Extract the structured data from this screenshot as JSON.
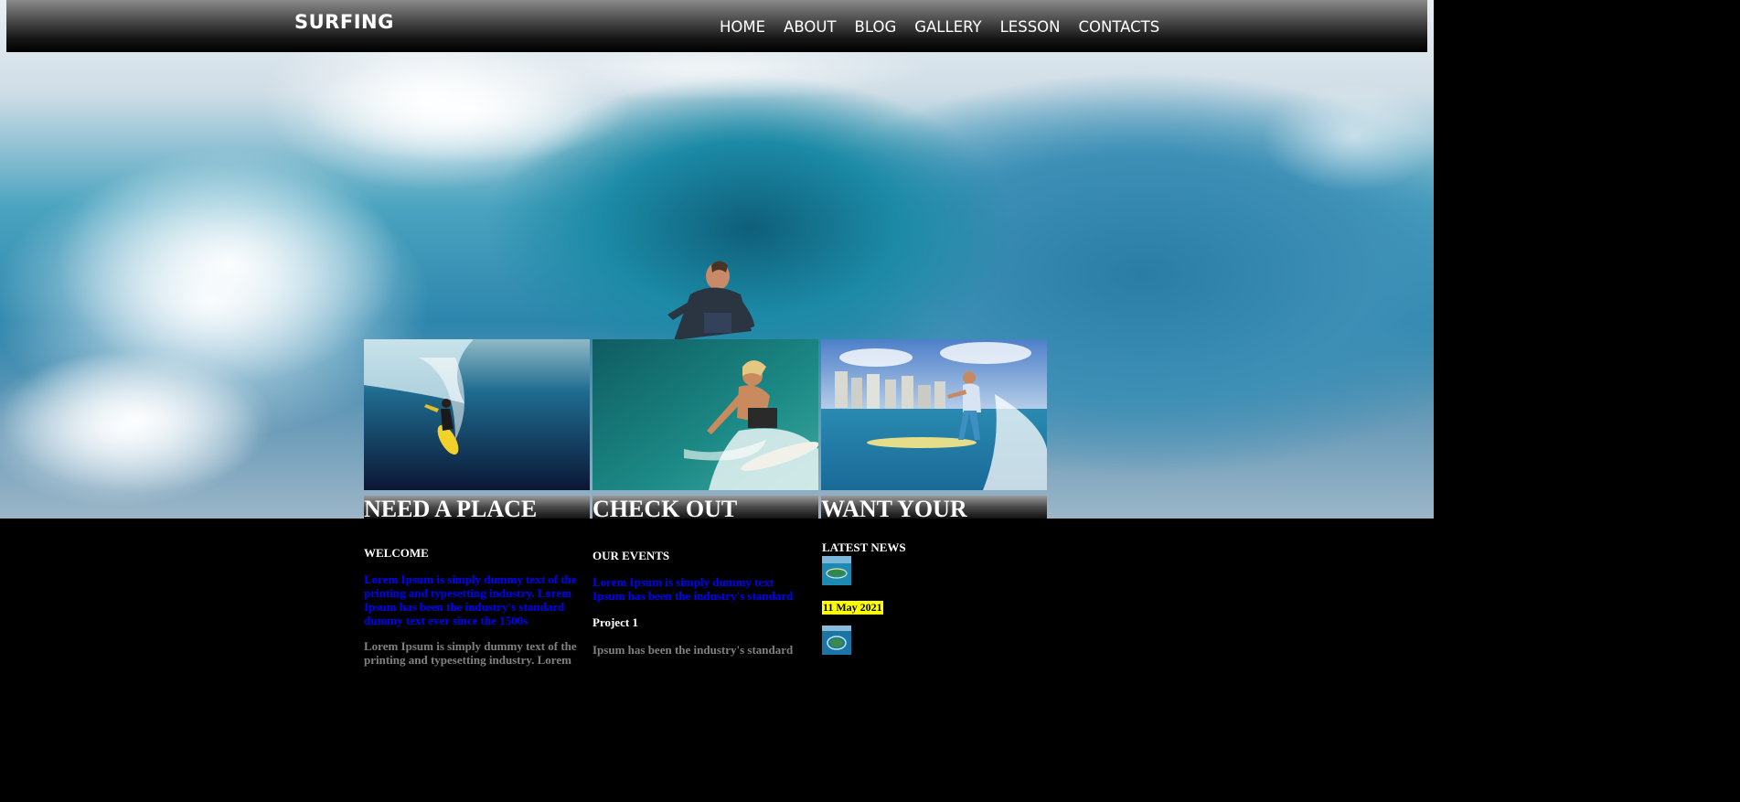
{
  "site": {
    "logo": "SURFING"
  },
  "nav": {
    "items": [
      "HOME",
      "ABOUT",
      "BLOG",
      "GALLERY",
      "LESSON",
      "CONTACTS"
    ]
  },
  "cards": [
    {
      "caption": "NEED A PLACE"
    },
    {
      "caption": "CHECK OUT"
    },
    {
      "caption": "WANT YOUR"
    }
  ],
  "welcome": {
    "heading": "WELCOME",
    "blue_text": "Lorem Ipsum is simply dummy text of the printing and typesetting industry. Lorem Ipsum has been the industry's standard dummy text ever since the 1500s",
    "gray_text": "Lorem Ipsum is simply dummy text of the printing and typesetting industry. Lorem"
  },
  "events": {
    "heading": "OUR EVENTS",
    "blue_text": "Lorem Ipsum is simply dummy text Ipsum has been the industry's standard",
    "project_title": "Project 1",
    "gray_text": "Ipsum has been the industry's standard"
  },
  "news": {
    "heading": "LATEST NEWS",
    "date": "11 May 2021"
  },
  "colors": {
    "link_blue": "#0000ff",
    "muted_gray": "#808080",
    "date_highlight": "#ffff00"
  }
}
